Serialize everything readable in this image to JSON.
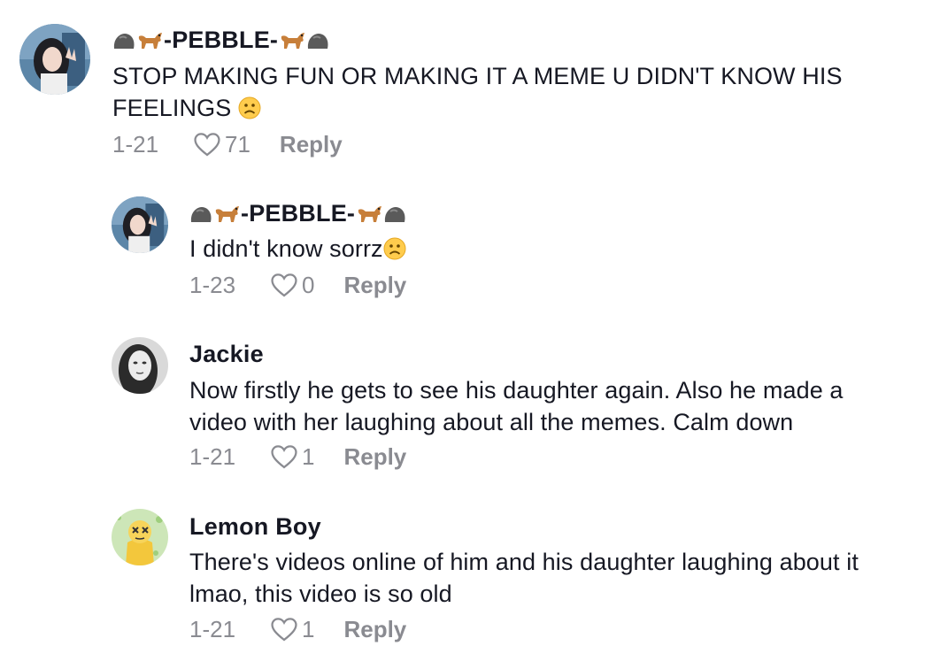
{
  "comments": [
    {
      "username": "-PEBBLE-",
      "text": "STOP MAKING FUN OR MAKING IT A MEME U DIDN'T KNOW HIS FEELINGS",
      "date": "1-21",
      "likes": "71",
      "reply_label": "Reply"
    },
    {
      "username": "-PEBBLE-",
      "text": "I didn't know sorrz",
      "date": "1-23",
      "likes": "0",
      "reply_label": "Reply"
    },
    {
      "username": "Jackie",
      "text_line1": "Now firstly he gets to see his daughter again. Also he made a",
      "text_line2": "video with her laughing about all the memes. Calm down",
      "date": "1-21",
      "likes": "1",
      "reply_label": "Reply"
    },
    {
      "username": "Lemon Boy",
      "text_line1": "There's videos online of him and his daughter laughing about it",
      "text_line2": "lmao, this video is so old",
      "date": "1-21",
      "likes": "1",
      "reply_label": "Reply"
    }
  ],
  "icons": {
    "name_decor": [
      "rock-icon",
      "dog-icon"
    ],
    "frown": "frowning-face-emoji",
    "like": "heart-outline-icon"
  }
}
